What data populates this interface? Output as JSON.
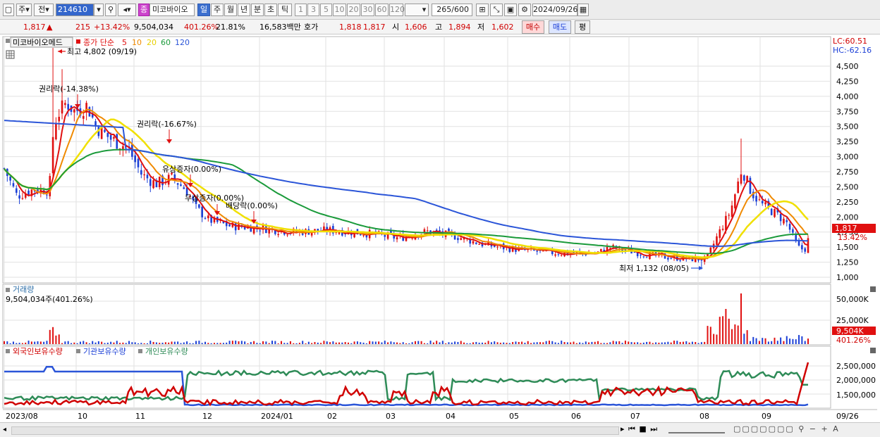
{
  "toolbar": {
    "market": "주",
    "prev_label": "전",
    "code": "214610",
    "stock_name_badge": "종",
    "stock_name": "미코바이오",
    "periods": [
      "일",
      "주",
      "월",
      "년",
      "분",
      "초",
      "틱"
    ],
    "period_selected": "일",
    "intervals": [
      "1",
      "3",
      "5",
      "10",
      "20",
      "30",
      "60",
      "120"
    ],
    "count": "265",
    "count_total": "/600",
    "date": "2024/09/26"
  },
  "quote": {
    "price": "1,817",
    "arrow": "▲",
    "change": "215",
    "change_pct": "+13.42%",
    "volume": "9,504,034",
    "volume_pct": "401.26%",
    "turnover": "21.81%",
    "amount": "16,583백만",
    "bid_label": "호가",
    "ask": "1,818",
    "bid": "1,817",
    "open_label": "시",
    "open": "1,606",
    "high_label": "고",
    "high": "1,894",
    "low_label": "저",
    "low": "1,602",
    "buy_button": "매수",
    "sell_button": "매도",
    "avg_button": "평"
  },
  "price_panel": {
    "stock_label": "미코바이오메드",
    "ma_label": "종가 단순",
    "ma_periods": [
      "5",
      "10",
      "20",
      "60",
      "120"
    ],
    "ma_colors": [
      "#e01010",
      "#f08a00",
      "#f0e000",
      "#1a9a3a",
      "#2b55d8"
    ],
    "lc": "LC:60.51",
    "hc": "HC:-62.16",
    "current_tag": "1,817",
    "current_pct": "13.42%",
    "y_ticks": [
      "4,500",
      "4,250",
      "4,000",
      "3,750",
      "3,500",
      "3,250",
      "3,000",
      "2,750",
      "2,500",
      "2,250",
      "2,000",
      "1,750",
      "1,500",
      "1,250",
      "1,000"
    ],
    "annotations": {
      "high": "최고 4,802 (09/19)",
      "rights1": "권리락(-14.38%)",
      "rights2": "권리락(-16.67%)",
      "paid": "유상증자(0.00%)",
      "bonus": "무상증자(0.00%)",
      "dividend": "배당락(0.00%)",
      "low": "최저 1,132 (08/05)"
    }
  },
  "volume_panel": {
    "title": "거래량",
    "value": "9,504,034주(401.26%)",
    "y_ticks": [
      "50,000K",
      "25,000K"
    ],
    "current_tag": "9,504K",
    "current_pct": "401.26%"
  },
  "holdings_panel": {
    "legend": [
      "외국인보유수량",
      "기관보유수량",
      "개인보유수량"
    ],
    "legend_colors": [
      "#d00000",
      "#2b55d8",
      "#2e8b57"
    ],
    "y_ticks": [
      "2,500,000",
      "2,000,000",
      "1,500,000"
    ]
  },
  "x_axis": {
    "labels": [
      "2023/08",
      "10",
      "11",
      "12",
      "2024/01",
      "02",
      "03",
      "04",
      "05",
      "06",
      "07",
      "08",
      "09"
    ],
    "end_label": "09/26"
  },
  "chart_data": {
    "type": "candlestick",
    "ma_periods": [
      5,
      10,
      20,
      60,
      120
    ],
    "high": {
      "value": 4802,
      "date": "09/19"
    },
    "low": {
      "value": 1132,
      "date": "08/05"
    },
    "close": 1817,
    "ylim": [
      1000,
      4500
    ]
  }
}
